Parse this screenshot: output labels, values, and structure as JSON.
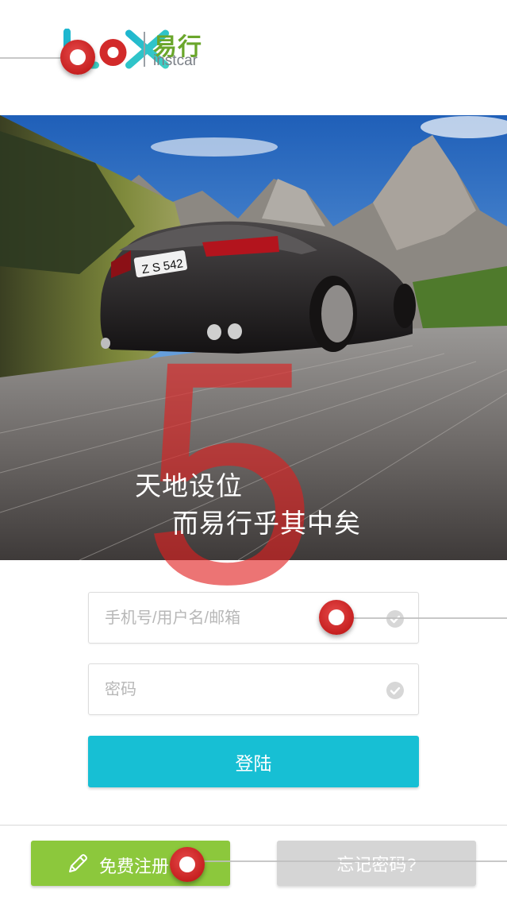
{
  "header": {
    "brand_cn": "易行",
    "brand_en": "instcar",
    "accent_color": "#6aa62b"
  },
  "hero": {
    "slogan_line1": "天地设位",
    "slogan_line2": "而易行乎其中矣",
    "overlay_digit": "5"
  },
  "form": {
    "username_placeholder": "手机号/用户名/邮箱",
    "password_placeholder": "密码",
    "login_label": "登陆",
    "login_color": "#17bfd4"
  },
  "footer": {
    "register_label": "免费注册",
    "forgot_label": "忘记密码?",
    "register_color": "#8cc83c"
  },
  "icons": [
    "logo-icon",
    "check-circle-icon",
    "pencil-icon",
    "tutorial-marker-icon"
  ]
}
